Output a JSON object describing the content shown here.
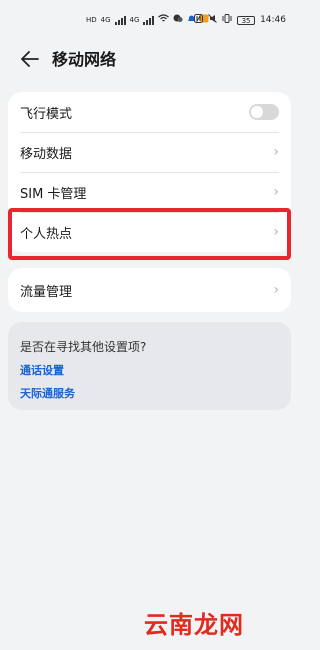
{
  "status_bar": {
    "left_signal_1": "HD",
    "left_signal_2": "HD",
    "net_1": "4G",
    "net_2": "4G",
    "battery": "35",
    "time": "14:46"
  },
  "header": {
    "title": "移动网络"
  },
  "group1": {
    "items": [
      {
        "label": "飞行模式"
      },
      {
        "label": "移动数据"
      },
      {
        "label": "SIM 卡管理"
      },
      {
        "label": "个人热点"
      }
    ]
  },
  "group2": {
    "items": [
      {
        "label": "流量管理"
      }
    ]
  },
  "suggestions": {
    "question": "是否在寻找其他设置项?",
    "links": [
      "通话设置",
      "天际通服务"
    ]
  },
  "watermark": "云南龙网",
  "colors": {
    "highlight": "#e8262d",
    "link": "#1a61d6"
  }
}
